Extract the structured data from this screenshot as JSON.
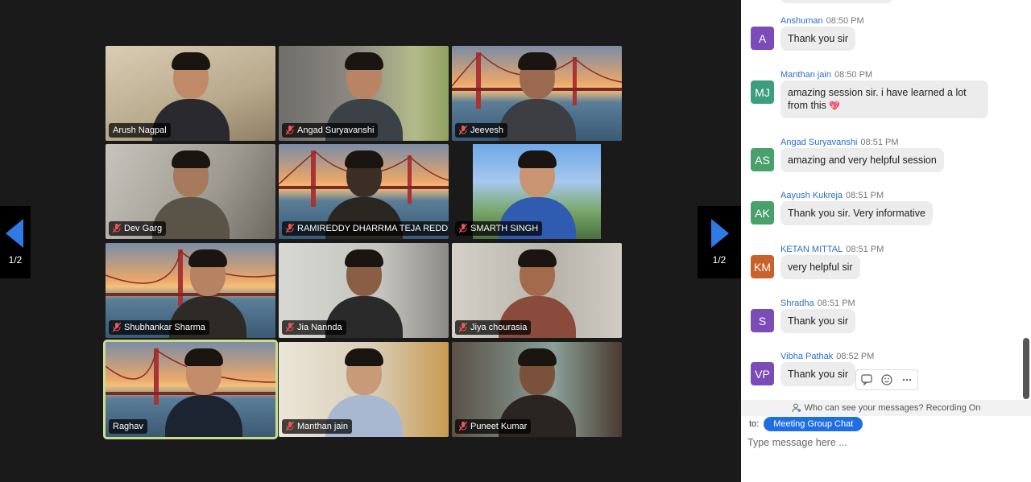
{
  "navigation": {
    "page_indicator": "1/2"
  },
  "participants": [
    {
      "name": "Arush Nagpal",
      "muted": false,
      "background": "room"
    },
    {
      "name": "Angad Suryavanshi",
      "muted": true,
      "background": "room"
    },
    {
      "name": "Jeevesh",
      "muted": true,
      "background": "golden-gate"
    },
    {
      "name": "Dev Garg",
      "muted": true,
      "background": "room"
    },
    {
      "name": "RAMIREDDY DHARRMA TEJA REDDY",
      "muted": true,
      "background": "golden-gate"
    },
    {
      "name": "SMARTH SINGH",
      "muted": true,
      "background": "outdoor"
    },
    {
      "name": "Shubhankar Sharma",
      "muted": true,
      "background": "golden-gate"
    },
    {
      "name": "Jia Nannda",
      "muted": true,
      "background": "room"
    },
    {
      "name": "Jiya chourasia",
      "muted": true,
      "background": "room"
    },
    {
      "name": "Raghav",
      "muted": false,
      "background": "golden-gate",
      "active_speaker": true
    },
    {
      "name": "Manthan jain",
      "muted": true,
      "background": "room"
    },
    {
      "name": "Puneet Kumar",
      "muted": true,
      "background": "room"
    }
  ],
  "chat": {
    "messages": [
      {
        "sender": "Anshuman",
        "time": "08:50 PM",
        "initials": "A",
        "avatar_color": "#7b4bb8",
        "text": "Thank you sir"
      },
      {
        "sender": "Manthan jain",
        "time": "08:50 PM",
        "initials": "MJ",
        "avatar_color": "#3d9e7f",
        "text": "amazing session sir. i have learned a lot from this",
        "emoji": "💖"
      },
      {
        "sender": "Angad Suryavanshi",
        "time": "08:51 PM",
        "initials": "AS",
        "avatar_color": "#4aa06a",
        "text": "amazing and very helpful session"
      },
      {
        "sender": "Aayush Kukreja",
        "time": "08:51 PM",
        "initials": "AK",
        "avatar_color": "#4aa06a",
        "text": "Thank you sir. Very informative"
      },
      {
        "sender": "KETAN MITTAL",
        "time": "08:51 PM",
        "initials": "KM",
        "avatar_color": "#c8622a",
        "text": "very helpful sir"
      },
      {
        "sender": "Shradha",
        "time": "08:51 PM",
        "initials": "S",
        "avatar_color": "#7b4bb8",
        "text": "Thank you sir"
      },
      {
        "sender": "Vibha Pathak",
        "time": "08:52 PM",
        "initials": "VP",
        "avatar_color": "#7b4bb8",
        "text": "Thank you sir"
      }
    ],
    "privacy_notice": "Who can see your messages? Recording On",
    "to_label": "to:",
    "recipient": "Meeting Group Chat",
    "input_placeholder": "Type message here ..."
  },
  "colors": {
    "accent": "#1f6fe0",
    "nav_arrow": "#2f7be6",
    "active_outline": "#c8dc8c"
  }
}
